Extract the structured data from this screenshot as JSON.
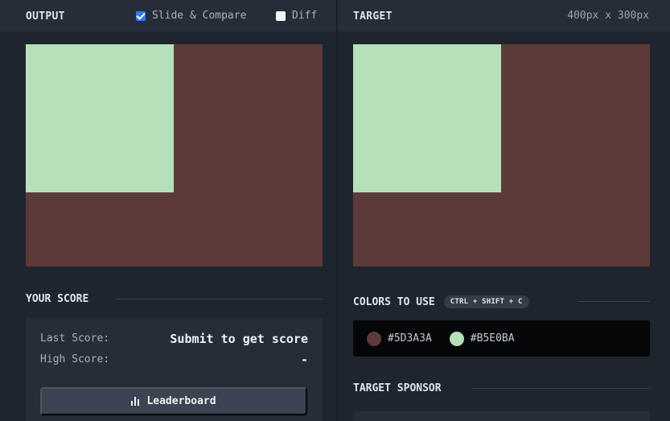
{
  "output": {
    "title": "OUTPUT",
    "slide_compare_label": "Slide & Compare",
    "slide_compare_checked": true,
    "diff_label": "Diff",
    "diff_checked": false
  },
  "target": {
    "title": "TARGET",
    "dimensions": "400px x 300px"
  },
  "colors": {
    "background": "#5D3A3A",
    "square": "#B5E0BA"
  },
  "score": {
    "heading": "YOUR SCORE",
    "last_label": "Last Score:",
    "last_value": "Submit to get score",
    "high_label": "High Score:",
    "high_value": "-",
    "leaderboard_label": "Leaderboard",
    "leaderboard_icon": "bar-chart-icon"
  },
  "palette": {
    "heading": "COLORS TO USE",
    "shortcut": "CTRL + SHIFT + C",
    "items": [
      {
        "hex": "#5D3A3A",
        "label": "#5D3A3A"
      },
      {
        "hex": "#B5E0BA",
        "label": "#B5E0BA"
      }
    ]
  },
  "sponsor": {
    "heading": "TARGET SPONSOR"
  }
}
